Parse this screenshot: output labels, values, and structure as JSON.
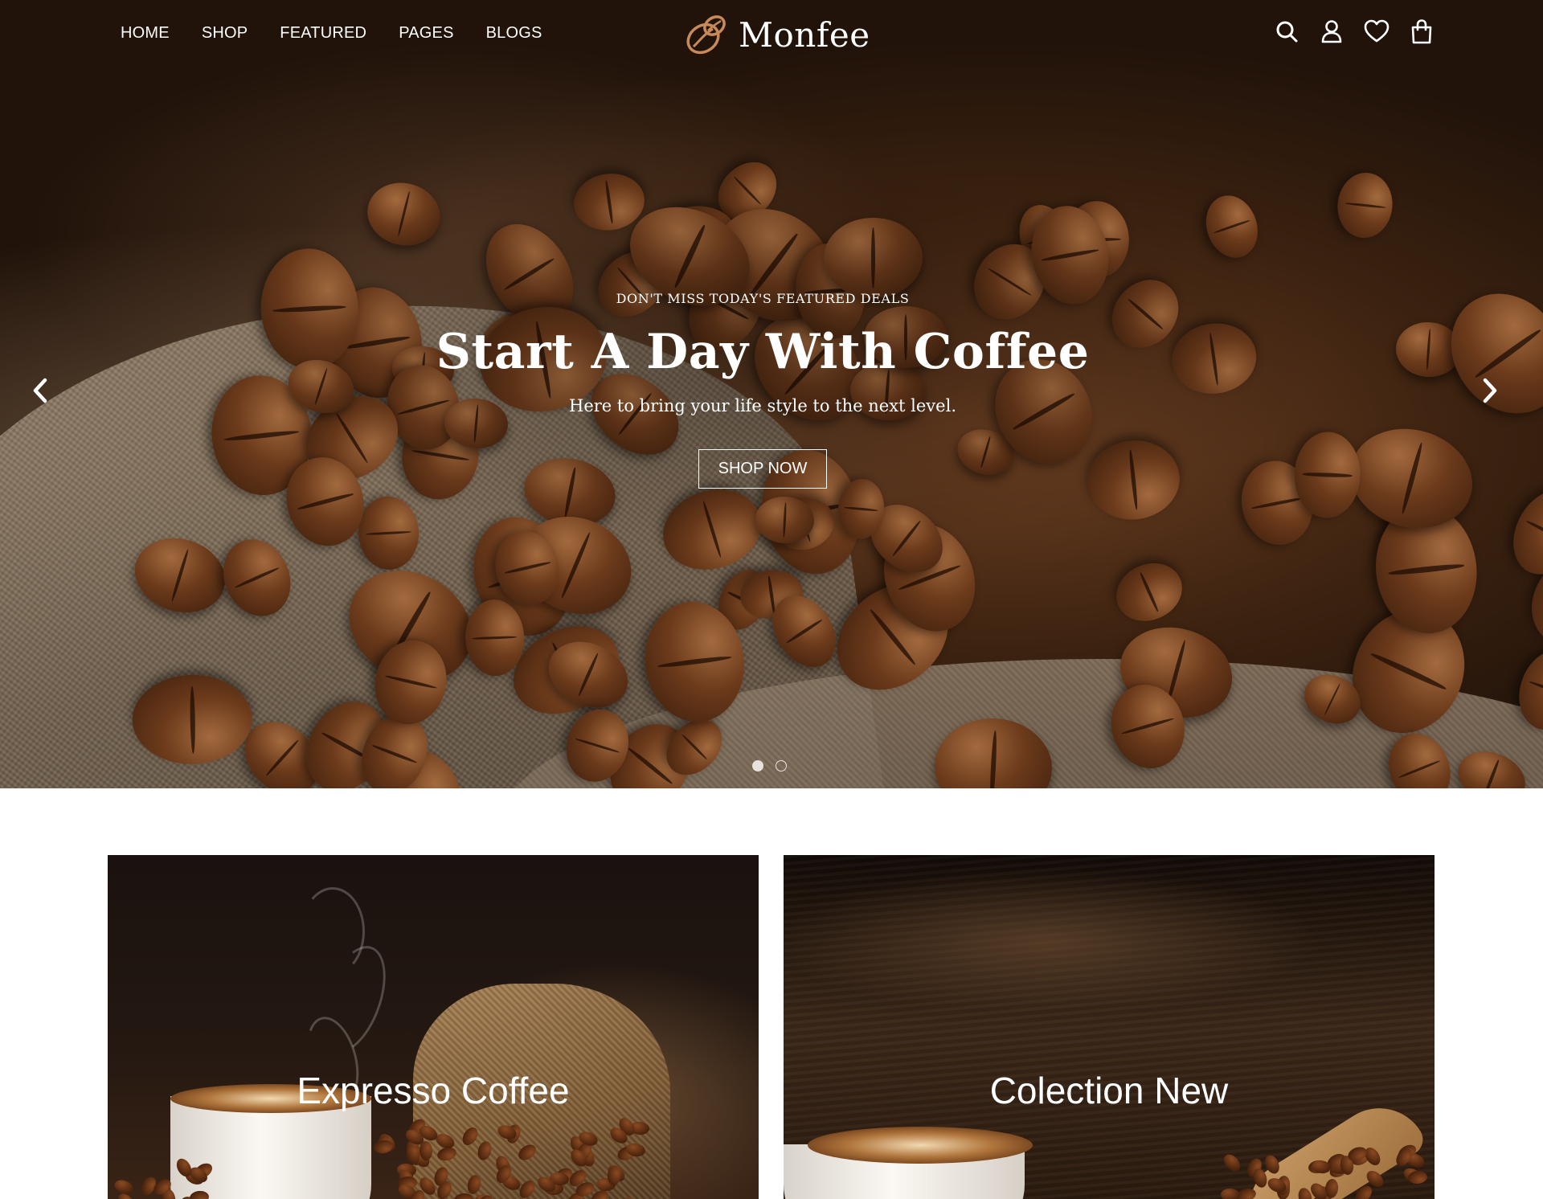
{
  "header": {
    "nav": [
      "HOME",
      "SHOP",
      "FEATURED",
      "PAGES",
      "BLOGS"
    ],
    "brand": "Monfee",
    "icons": [
      "search-icon",
      "account-icon",
      "wishlist-heart-icon",
      "shopping-bag-icon"
    ]
  },
  "hero": {
    "eyebrow": "DON'T MISS TODAY'S FEATURED DEALS",
    "title": "Start A Day With Coffee",
    "subtitle": "Here to bring your life style to the next level.",
    "cta": "SHOP NOW",
    "slides": {
      "count": 2,
      "active": 1
    }
  },
  "promos": [
    {
      "title": "Expresso Coffee"
    },
    {
      "title": "Colection New"
    }
  ],
  "colors": {
    "brand_accent": "#c98a5a",
    "text_light": "#ffffff",
    "hero_dark": "#3c2210"
  }
}
